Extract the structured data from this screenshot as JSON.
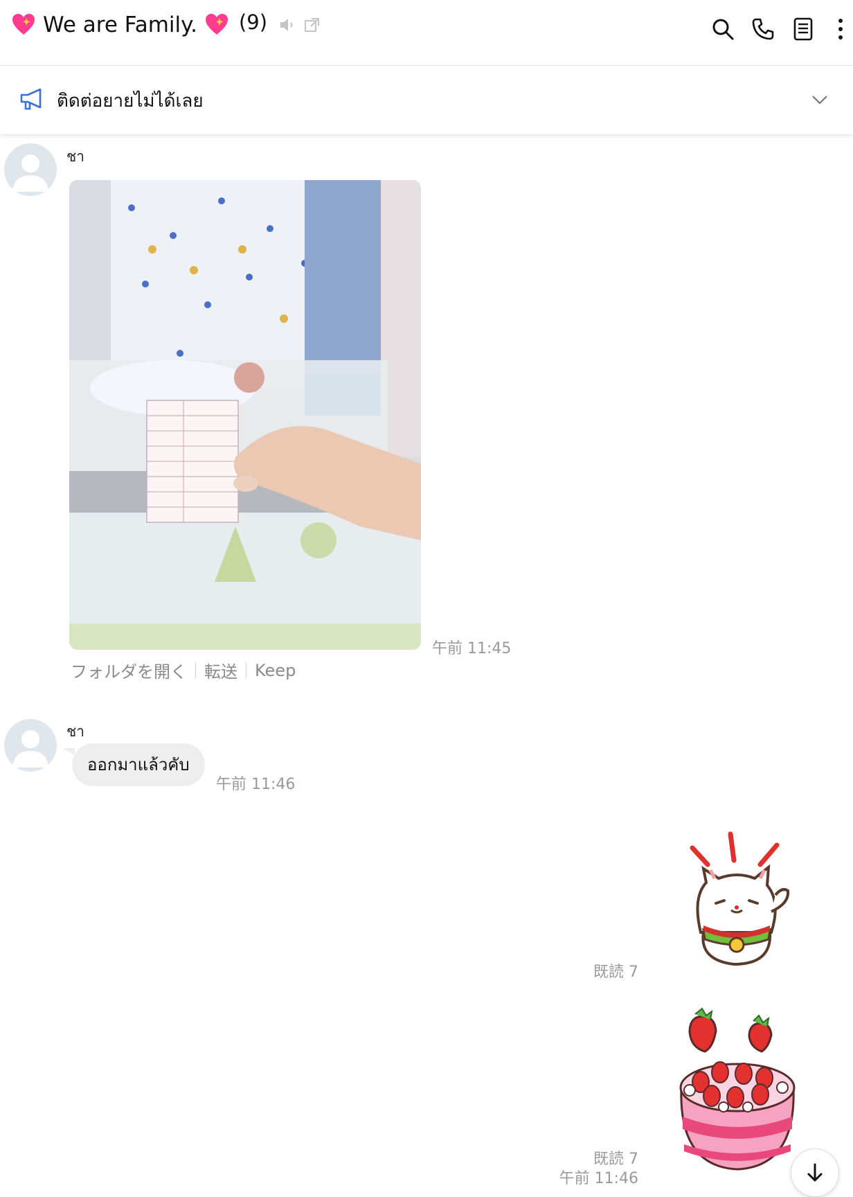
{
  "header": {
    "title": "We are Family.",
    "member_count": "(9)",
    "icons": [
      "heart-sparkle-icon",
      "speaker-muted-icon",
      "external-window-icon",
      "search-icon",
      "phone-icon",
      "notes-icon",
      "more-icon"
    ]
  },
  "notice": {
    "text": "ติดต่อยายไม่ได้เลย",
    "icon": "megaphone-icon"
  },
  "messages": [
    {
      "sender": "ชา",
      "type": "image",
      "time": "午前 11:45",
      "actions": [
        "フォルダを開く",
        "転送",
        "Keep"
      ]
    },
    {
      "sender": "ชา",
      "type": "text",
      "text": "ออกมาแล้วคับ",
      "time": "午前 11:46"
    },
    {
      "type": "sticker",
      "sticker": "lucky-cat",
      "read": "既読 7"
    },
    {
      "type": "sticker",
      "sticker": "strawberry-cake",
      "read": "既読 7",
      "time": "午前 11:46"
    }
  ]
}
